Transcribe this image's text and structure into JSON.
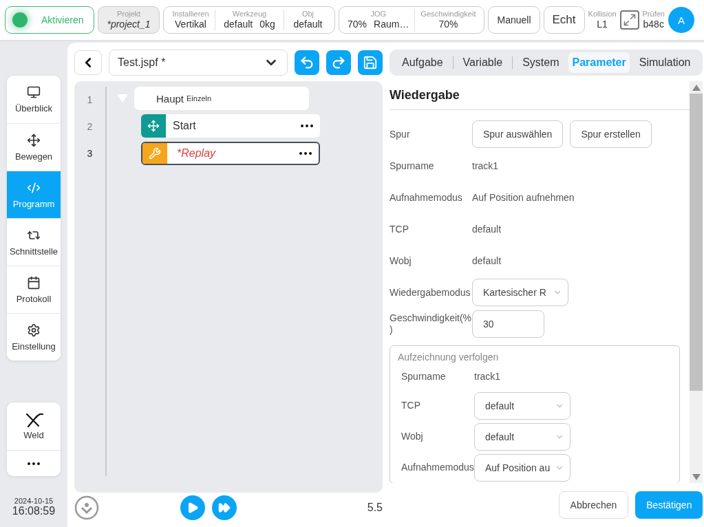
{
  "top_bar": {
    "activate": {
      "label": "Aktivieren",
      "on": true
    },
    "project": {
      "label": "Projekt",
      "value": "*project_1"
    },
    "setup_group": [
      {
        "label": "Installieren",
        "values": [
          "Vertikal"
        ]
      },
      {
        "label": "Werkzeug",
        "values": [
          "default",
          "0kg"
        ]
      },
      {
        "label": "Obj",
        "values": [
          "default"
        ]
      }
    ],
    "motion_group": [
      {
        "label": "JOG",
        "values": [
          "70%",
          "Raum…"
        ]
      },
      {
        "label": "Geschwindigkeit",
        "values": [
          "70%"
        ]
      }
    ],
    "mode_buttons": [
      "Manuell",
      "Echt"
    ],
    "collision": {
      "label": "Kollision",
      "value": "L1"
    },
    "check": {
      "label": "Prüfen",
      "value": "b48c"
    },
    "avatar": "A"
  },
  "sidebar": {
    "items": [
      {
        "label": "Überblick",
        "kind": "monitor",
        "selected": false
      },
      {
        "label": "Bewegen",
        "kind": "move",
        "selected": false
      },
      {
        "label": "Programm",
        "kind": "code",
        "selected": true
      },
      {
        "label": "Schnittstelle",
        "kind": "swap",
        "selected": false
      },
      {
        "label": "Protokoll",
        "kind": "calendar",
        "selected": false
      },
      {
        "label": "Einstellung",
        "kind": "gear",
        "selected": false
      }
    ],
    "extra_items": [
      {
        "label": "Weld",
        "kind": "weld"
      },
      {
        "kind": "more"
      }
    ],
    "date": "2024-10-15",
    "time": "16:08:59"
  },
  "editor": {
    "file": "Test.jspf *",
    "line_numbers": [
      "1",
      "2",
      "3"
    ],
    "root": {
      "label": "Haupt",
      "note": "Einzeln",
      "expanded": true,
      "children": [
        {
          "label": "Start",
          "kind": "move",
          "selected": false,
          "unsaved": false
        },
        {
          "label": "*Replay",
          "kind": "tool",
          "selected": true,
          "unsaved": true
        }
      ]
    },
    "speed": "5.5"
  },
  "panel": {
    "tabs": [
      {
        "label": "Aufgabe",
        "selected": false
      },
      {
        "label": "Variable",
        "selected": false
      },
      {
        "label": "System",
        "selected": false
      },
      {
        "label": "Parameter",
        "selected": true
      },
      {
        "label": "Simulation",
        "selected": false
      }
    ],
    "title": "Wiedergabe",
    "rows": [
      {
        "label": "Spur",
        "kind": "buttons",
        "buttons": [
          "Spur auswählen",
          "Spur erstellen"
        ]
      },
      {
        "label": "Spurname",
        "kind": "text",
        "value": "track1"
      },
      {
        "label": "Aufnahmemodus",
        "kind": "text",
        "value": "Auf Position aufnehmen"
      },
      {
        "label": "TCP",
        "kind": "text",
        "value": "default"
      },
      {
        "label": "Wobj",
        "kind": "text",
        "value": "default"
      },
      {
        "label": "Wiedergabemodus",
        "kind": "select",
        "value": "Kartesischer R"
      },
      {
        "label": "Geschwindigkeit(%)",
        "kind": "input",
        "value": "30"
      }
    ],
    "group": {
      "title": "Aufzeichnung verfolgen",
      "rows": [
        {
          "label": "Spurname",
          "kind": "text",
          "value": "track1"
        },
        {
          "label": "TCP",
          "kind": "select",
          "value": "default"
        },
        {
          "label": "Wobj",
          "kind": "select",
          "value": "default"
        },
        {
          "label": "Aufnahmemodus",
          "kind": "select",
          "value": "Auf Position au"
        }
      ]
    },
    "footer_buttons": [
      {
        "label": "Abbrechen",
        "kind": "secondary"
      },
      {
        "label": "Bestätigen",
        "kind": "primary"
      }
    ]
  }
}
